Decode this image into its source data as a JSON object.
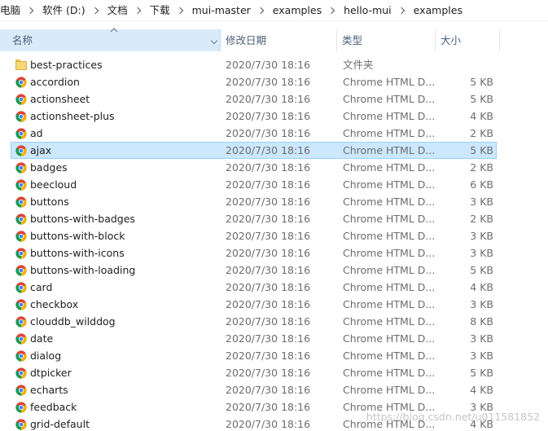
{
  "breadcrumb": [
    "电脑",
    "软件 (D:)",
    "文档",
    "下载",
    "mui-master",
    "examples",
    "hello-mui",
    "examples"
  ],
  "columns": {
    "name": "名称",
    "date": "修改日期",
    "type": "类型",
    "size": "大小"
  },
  "files": [
    {
      "name": "best-practices",
      "date": "2020/7/30 18:16",
      "type": "文件夹",
      "size": "",
      "icon": "folder-icon"
    },
    {
      "name": "accordion",
      "date": "2020/7/30 18:16",
      "type": "Chrome HTML D...",
      "size": "5 KB",
      "icon": "chrome-icon"
    },
    {
      "name": "actionsheet",
      "date": "2020/7/30 18:16",
      "type": "Chrome HTML D...",
      "size": "5 KB",
      "icon": "chrome-icon"
    },
    {
      "name": "actionsheet-plus",
      "date": "2020/7/30 18:16",
      "type": "Chrome HTML D...",
      "size": "4 KB",
      "icon": "chrome-icon"
    },
    {
      "name": "ad",
      "date": "2020/7/30 18:16",
      "type": "Chrome HTML D...",
      "size": "2 KB",
      "icon": "chrome-icon"
    },
    {
      "name": "ajax",
      "date": "2020/7/30 18:16",
      "type": "Chrome HTML D...",
      "size": "5 KB",
      "icon": "chrome-icon",
      "selected": true
    },
    {
      "name": "badges",
      "date": "2020/7/30 18:16",
      "type": "Chrome HTML D...",
      "size": "2 KB",
      "icon": "chrome-icon"
    },
    {
      "name": "beecloud",
      "date": "2020/7/30 18:16",
      "type": "Chrome HTML D...",
      "size": "6 KB",
      "icon": "chrome-icon"
    },
    {
      "name": "buttons",
      "date": "2020/7/30 18:16",
      "type": "Chrome HTML D...",
      "size": "3 KB",
      "icon": "chrome-icon"
    },
    {
      "name": "buttons-with-badges",
      "date": "2020/7/30 18:16",
      "type": "Chrome HTML D...",
      "size": "2 KB",
      "icon": "chrome-icon"
    },
    {
      "name": "buttons-with-block",
      "date": "2020/7/30 18:16",
      "type": "Chrome HTML D...",
      "size": "3 KB",
      "icon": "chrome-icon"
    },
    {
      "name": "buttons-with-icons",
      "date": "2020/7/30 18:16",
      "type": "Chrome HTML D...",
      "size": "3 KB",
      "icon": "chrome-icon"
    },
    {
      "name": "buttons-with-loading",
      "date": "2020/7/30 18:16",
      "type": "Chrome HTML D...",
      "size": "5 KB",
      "icon": "chrome-icon"
    },
    {
      "name": "card",
      "date": "2020/7/30 18:16",
      "type": "Chrome HTML D...",
      "size": "4 KB",
      "icon": "chrome-icon"
    },
    {
      "name": "checkbox",
      "date": "2020/7/30 18:16",
      "type": "Chrome HTML D...",
      "size": "3 KB",
      "icon": "chrome-icon"
    },
    {
      "name": "clouddb_wilddog",
      "date": "2020/7/30 18:16",
      "type": "Chrome HTML D...",
      "size": "8 KB",
      "icon": "chrome-icon"
    },
    {
      "name": "date",
      "date": "2020/7/30 18:16",
      "type": "Chrome HTML D...",
      "size": "3 KB",
      "icon": "chrome-icon"
    },
    {
      "name": "dialog",
      "date": "2020/7/30 18:16",
      "type": "Chrome HTML D...",
      "size": "3 KB",
      "icon": "chrome-icon"
    },
    {
      "name": "dtpicker",
      "date": "2020/7/30 18:16",
      "type": "Chrome HTML D...",
      "size": "5 KB",
      "icon": "chrome-icon"
    },
    {
      "name": "echarts",
      "date": "2020/7/30 18:16",
      "type": "Chrome HTML D...",
      "size": "4 KB",
      "icon": "chrome-icon"
    },
    {
      "name": "feedback",
      "date": "2020/7/30 18:16",
      "type": "Chrome HTML D...",
      "size": "3 KB",
      "icon": "chrome-icon"
    },
    {
      "name": "grid-default",
      "date": "2020/7/30 18:16",
      "type": "Chrome HTML D...",
      "size": "4 KB",
      "icon": "chrome-icon"
    }
  ],
  "watermark": "https://blog.csdn.net/u011581852",
  "colors": {
    "selected_bg": "#cce8ff",
    "selected_border": "#99d1ff",
    "header_sorted_bg": "#d9ebf9",
    "header_text": "#4c607a"
  }
}
